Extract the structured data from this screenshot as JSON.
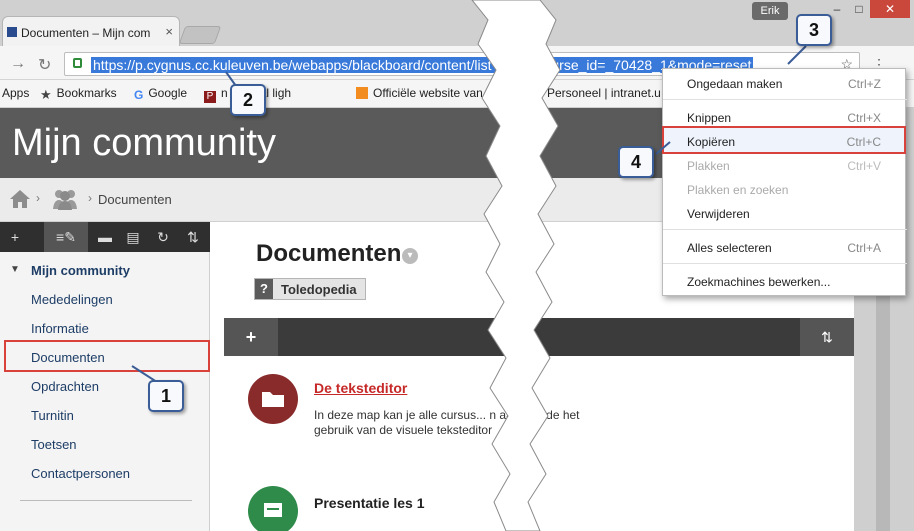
{
  "browser": {
    "tab_title": "Documenten – Mijn com",
    "tab_close": "×",
    "user_badge": "Erik",
    "win_min": "–",
    "win_max": "□",
    "win_close": "✕",
    "url": "https://p.cygnus.cc.kuleuven.be/webapps/blackboard/content/list",
    "url_tail": "1&course_id=_70428_1&mode=reset",
    "back_icon": "arrow-right",
    "reload_icon": "reload",
    "bookmarks": [
      {
        "label": "Apps",
        "icon": "apps-grid"
      },
      {
        "label": "Bookmarks",
        "icon": "star"
      },
      {
        "label": "Google",
        "icon": "google-g"
      },
      {
        "label": "n Portaal ligh",
        "icon": "p-square"
      },
      {
        "label": "Officiële website van",
        "icon": "orange-square"
      },
      {
        "label": "Personeel | intranet.u",
        "icon": "pink-circle"
      }
    ]
  },
  "page": {
    "banner_title": "Mijn community",
    "breadcrumb": "Documenten",
    "heading": "Documenten",
    "toledopedia": "Toledopedia",
    "toledopedia_icon": "?",
    "add_icon": "+",
    "sort_icon": "⇅"
  },
  "sidebar": {
    "section": "Mijn community",
    "items": [
      "Mededelingen",
      "Informatie",
      "Documenten",
      "Opdrachten",
      "Turnitin",
      "Toetsen",
      "Contactpersonen"
    ]
  },
  "content_items": [
    {
      "title": "De teksteditor",
      "desc": "In deze map kan je alle cursus... n aangaande het gebruik van de visuele teksteditor",
      "icon": "folder-icon"
    },
    {
      "title": "Presentatie les 1",
      "icon": "presentation-icon"
    }
  ],
  "context_menu": {
    "items": [
      {
        "label": "Ongedaan maken",
        "shortcut": "Ctrl+Z",
        "enabled": true
      },
      {
        "label": "Knippen",
        "shortcut": "Ctrl+X",
        "enabled": true
      },
      {
        "label": "Kopiëren",
        "shortcut": "Ctrl+C",
        "enabled": true
      },
      {
        "label": "Plakken",
        "shortcut": "Ctrl+V",
        "enabled": false
      },
      {
        "label": "Plakken en zoeken",
        "shortcut": "",
        "enabled": false
      },
      {
        "label": "Verwijderen",
        "shortcut": "",
        "enabled": true
      },
      {
        "label": "Alles selecteren",
        "shortcut": "Ctrl+A",
        "enabled": true
      },
      {
        "label": "Zoekmachines bewerken...",
        "shortcut": "",
        "enabled": true
      }
    ]
  },
  "callouts": [
    "1",
    "2",
    "3",
    "4"
  ],
  "colors": {
    "highlight": "#d8423b",
    "callout_border": "#3b5d97",
    "selection": "#3879d9",
    "banner": "#5a5a5a"
  }
}
